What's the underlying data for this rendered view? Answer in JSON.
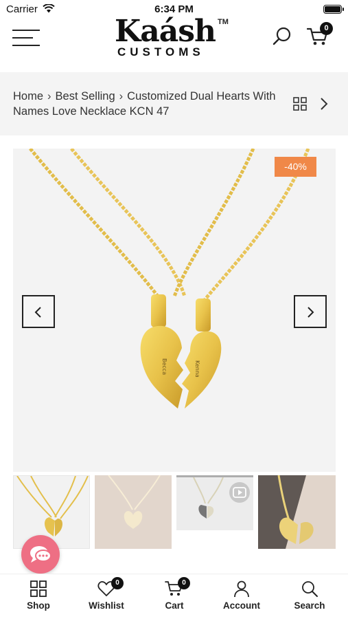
{
  "status_bar": {
    "carrier": "Carrier",
    "time": "6:34 PM"
  },
  "header": {
    "logo_text": "Kaásh",
    "logo_tm": "TM",
    "logo_sub": "CUSTOMS",
    "cart_count": "0"
  },
  "breadcrumb": {
    "home": "Home",
    "category": "Best Selling",
    "current": "Customized Dual Hearts With Names Love Necklace KCN 47"
  },
  "product": {
    "discount_badge": "-40%",
    "image_icon": "necklace-photo",
    "thumbnail_count": 4,
    "selected_thumbnail": 1
  },
  "bottom_nav": {
    "items": [
      {
        "label": "Shop",
        "icon": "grid-icon"
      },
      {
        "label": "Wishlist",
        "icon": "heart-icon",
        "badge": "0"
      },
      {
        "label": "Cart",
        "icon": "cart-icon",
        "badge": "0"
      },
      {
        "label": "Account",
        "icon": "user-icon"
      },
      {
        "label": "Search",
        "icon": "search-icon"
      }
    ]
  },
  "colors": {
    "accent_badge": "#f08848",
    "chat_button": "#ee6f84",
    "breadcrumb_bg": "#f4f4f4"
  }
}
